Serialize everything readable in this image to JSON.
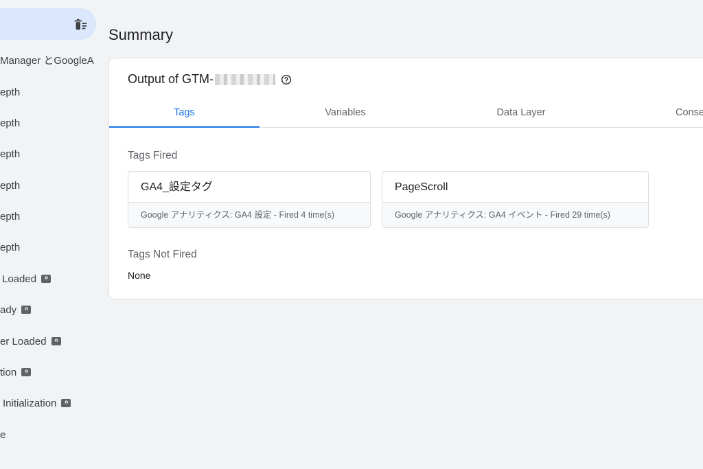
{
  "sidebar": {
    "items": [
      {
        "label": "Manager とGoogleA",
        "badge": false
      },
      {
        "label": "epth",
        "badge": false
      },
      {
        "label": "epth",
        "badge": false
      },
      {
        "label": "epth",
        "badge": false
      },
      {
        "label": "epth",
        "badge": false
      },
      {
        "label": "epth",
        "badge": false
      },
      {
        "label": "epth",
        "badge": false
      },
      {
        "label": "Loaded",
        "badge": true
      },
      {
        "label": "ady",
        "badge": true
      },
      {
        "label": "er Loaded",
        "badge": true
      },
      {
        "label": "tion",
        "badge": true
      },
      {
        "label": "Initialization",
        "badge": true
      },
      {
        "label": "e",
        "badge": false
      }
    ]
  },
  "header": {
    "title": "Summary"
  },
  "output": {
    "title": "Output of GTM-",
    "tabs": [
      "Tags",
      "Variables",
      "Data Layer",
      "Conse"
    ],
    "tags_fired_label": "Tags Fired",
    "tags_fired": [
      {
        "name": "GA4_設定タグ",
        "meta": "Google アナリティクス: GA4 設定 - Fired 4 time(s)"
      },
      {
        "name": "PageScroll",
        "meta": "Google アナリティクス: GA4 イベント - Fired 29 time(s)"
      }
    ],
    "tags_not_fired_label": "Tags Not Fired",
    "tags_not_fired_value": "None"
  },
  "colors": {
    "accent": "#1a73e8",
    "selected_bg": "#dbe7fd",
    "page_bg": "#f1f3f4"
  }
}
